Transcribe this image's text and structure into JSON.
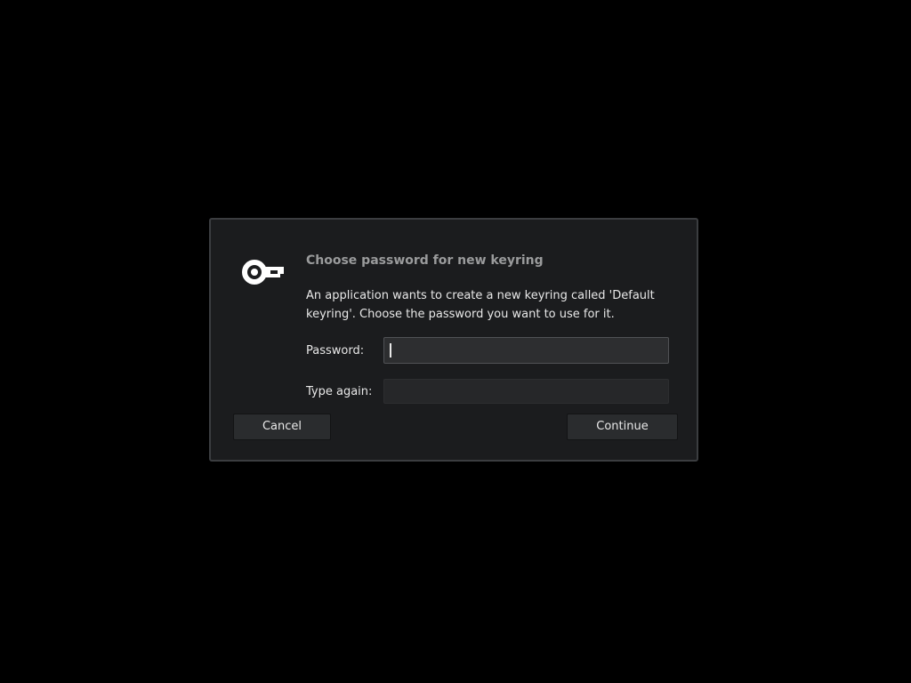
{
  "dialog": {
    "icon": "key-icon",
    "title": "Choose password for new keyring",
    "message": "An application wants to create a new keyring called 'Default keyring'. Choose the password you want to use for it.",
    "password_label": "Password:",
    "password_value": "",
    "type_again_label": "Type again:",
    "type_again_value": "",
    "cancel_label": "Cancel",
    "continue_label": "Continue"
  }
}
